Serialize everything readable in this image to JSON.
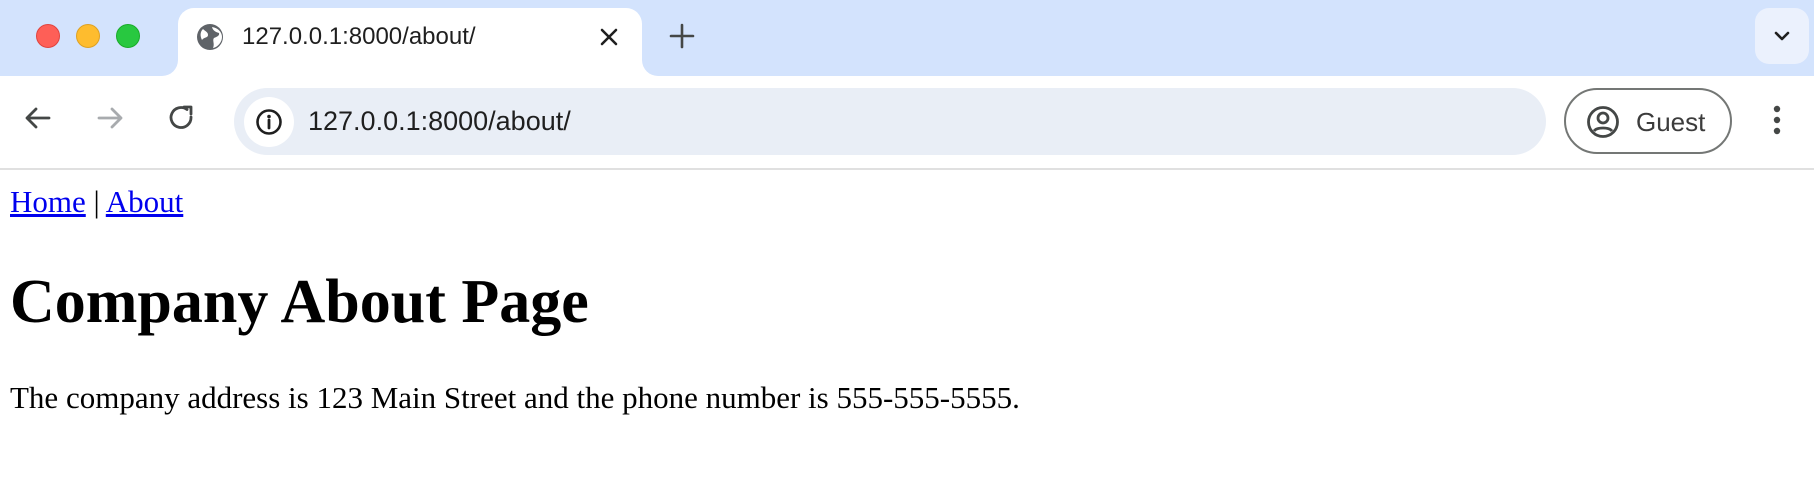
{
  "browser": {
    "tab": {
      "title": "127.0.0.1:8000/about/",
      "favicon": "globe-icon",
      "close_icon": "close-icon"
    },
    "new_tab_icon": "plus-icon",
    "tab_search_icon": "chevron-down-icon",
    "toolbar": {
      "back_icon": "arrow-left-icon",
      "forward_icon": "arrow-right-icon",
      "reload_icon": "reload-icon",
      "site_info_icon": "info-icon",
      "url": "127.0.0.1:8000/about/",
      "profile_label": "Guest",
      "profile_icon": "account-circle-icon",
      "menu_icon": "more-vertical-icon"
    },
    "colors": {
      "tabstrip_bg": "#d3e3fd",
      "omnibox_bg": "#e9eef6",
      "link": "#0000ee"
    }
  },
  "page": {
    "nav": {
      "links": [
        {
          "label": "Home"
        },
        {
          "label": "About"
        }
      ],
      "separator": "|"
    },
    "heading": "Company About Page",
    "paragraph": "The company address is 123 Main Street and the phone number is 555-555-5555."
  }
}
